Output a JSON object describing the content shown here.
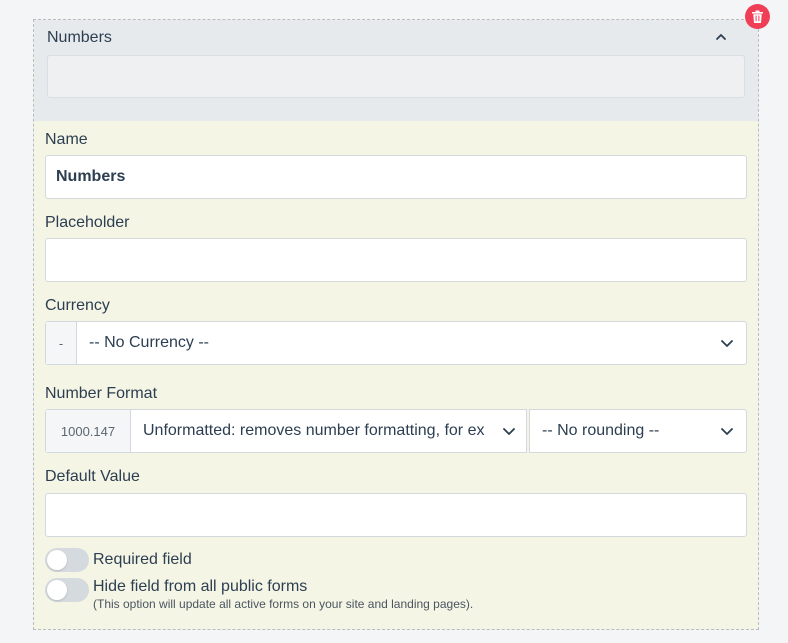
{
  "header": {
    "title": "Numbers"
  },
  "fields": {
    "name": {
      "label": "Name",
      "value": "Numbers"
    },
    "placeholder": {
      "label": "Placeholder",
      "value": ""
    },
    "currency": {
      "label": "Currency",
      "addon": "-",
      "selected": "-- No Currency --"
    },
    "number_format": {
      "label": "Number Format",
      "addon": "1000.147",
      "format_selected": "Unformatted: removes number formatting, for ex",
      "rounding_selected": "-- No rounding --"
    },
    "default_value": {
      "label": "Default Value",
      "value": ""
    }
  },
  "toggles": {
    "required": {
      "label": "Required field",
      "on": false
    },
    "hide": {
      "label": "Hide field from all public forms",
      "hint": "(This option will update all active forms on your site and landing pages).",
      "on": false
    }
  },
  "icons": {
    "delete": "trash-icon",
    "collapse": "chevron-up-icon",
    "dropdown": "chevron-down-icon"
  },
  "colors": {
    "delete_button": "#f03e57",
    "card_body": "#f5f5e6",
    "card_header": "#e6eaed"
  }
}
